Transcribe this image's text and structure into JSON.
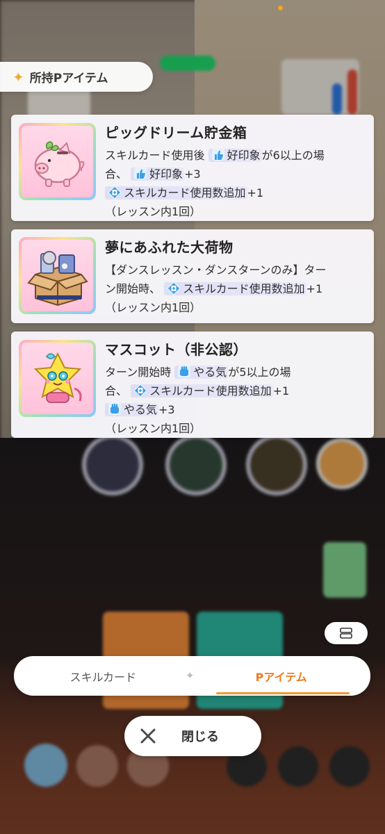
{
  "header": {
    "title": "所持Pアイテム"
  },
  "items": [
    {
      "name": "ピッグドリーム貯金箱",
      "desc_lines": [
        {
          "parts": [
            {
              "text": "スキルカード使用後 "
            },
            {
              "icon": "thumbs-up-icon",
              "hl": true,
              "text": "好印象"
            },
            {
              "text": "が6以上の場"
            }
          ]
        },
        {
          "parts": [
            {
              "text": "合、 "
            },
            {
              "icon": "thumbs-up-icon",
              "hl": true,
              "text": "好印象"
            },
            {
              "text": "+3"
            }
          ]
        },
        {
          "parts": [
            {
              "icon": "card-plus-icon",
              "hl": true,
              "text": "スキルカード使用数追加"
            },
            {
              "text": "+1"
            }
          ]
        },
        {
          "parts": [
            {
              "text": "（レッスン内1回）"
            }
          ]
        }
      ]
    },
    {
      "name": "夢にあふれた大荷物",
      "desc_lines": [
        {
          "parts": [
            {
              "text": "【ダンスレッスン・ダンスターンのみ】ター"
            }
          ]
        },
        {
          "parts": [
            {
              "text": "ン開始時、 "
            },
            {
              "icon": "card-plus-icon",
              "hl": true,
              "text": "スキルカード使用数追加"
            },
            {
              "text": "+1"
            }
          ]
        },
        {
          "parts": [
            {
              "text": "（レッスン内1回）"
            }
          ]
        }
      ]
    },
    {
      "name": "マスコット（非公認）",
      "desc_lines": [
        {
          "parts": [
            {
              "text": "ターン開始時 "
            },
            {
              "icon": "fist-icon",
              "hl": true,
              "text": "やる気"
            },
            {
              "text": "が5以上の場"
            }
          ]
        },
        {
          "parts": [
            {
              "text": "合、 "
            },
            {
              "icon": "card-plus-icon",
              "hl": true,
              "text": "スキルカード使用数追加"
            },
            {
              "text": "+1"
            }
          ]
        },
        {
          "parts": [
            {
              "icon": "fist-icon",
              "hl": true,
              "text": "やる気"
            },
            {
              "text": "+3"
            }
          ]
        },
        {
          "parts": [
            {
              "text": "（レッスン内1回）"
            }
          ]
        }
      ]
    }
  ],
  "tabs": {
    "skill_card": "スキルカード",
    "p_item": "Pアイテム"
  },
  "close": {
    "label": "閉じる"
  },
  "colors": {
    "accent": "#f07a1e",
    "keyword_icon": "#3b9ee6"
  }
}
